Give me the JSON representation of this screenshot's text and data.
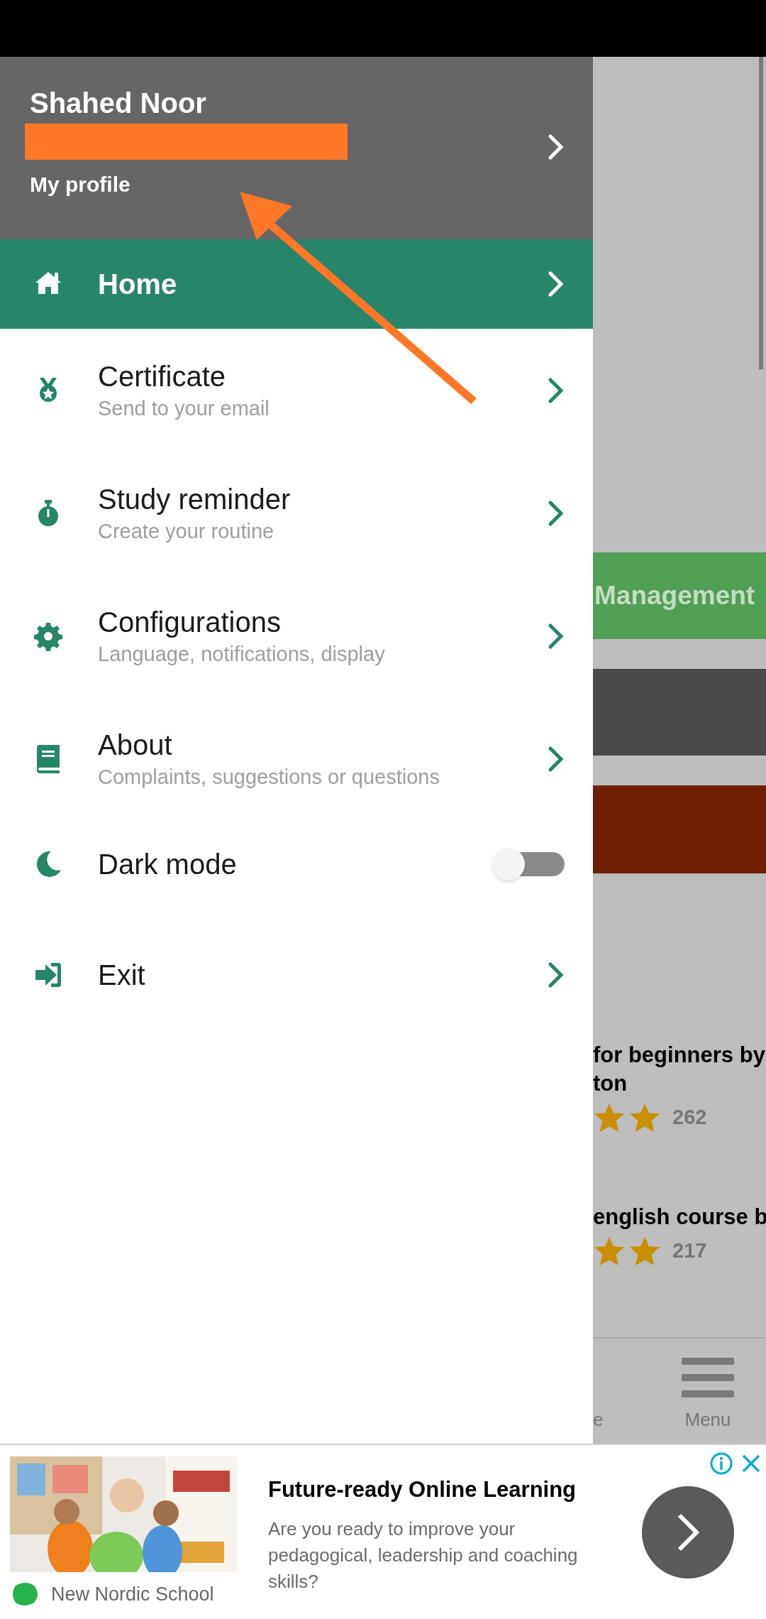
{
  "drawer": {
    "header": {
      "name": "Shahed Noor",
      "link": "My profile"
    },
    "items": [
      {
        "kind": "nav",
        "title": "Home",
        "selected": true
      },
      {
        "kind": "nav",
        "title": "Certificate",
        "subtitle": "Send to your email",
        "selected": false
      },
      {
        "kind": "nav",
        "title": "Study reminder",
        "subtitle": "Create your routine",
        "selected": false
      },
      {
        "kind": "nav",
        "title": "Configurations",
        "subtitle": "Language, notifications, display",
        "selected": false
      },
      {
        "kind": "nav",
        "title": "About",
        "subtitle": "Complaints, suggestions or questions",
        "selected": false
      },
      {
        "kind": "toggle",
        "title": "Dark mode",
        "on": false
      },
      {
        "kind": "nav",
        "title": "Exit",
        "selected": false
      }
    ]
  },
  "background": {
    "banner": "Management",
    "courses": [
      {
        "title_lines": [
          "for beginners by",
          "ton"
        ],
        "rating_count": "262"
      },
      {
        "title_lines": [
          "english course b"
        ],
        "rating_count": "217"
      }
    ],
    "bottom_nav": [
      {
        "label": "e"
      },
      {
        "label": "Menu"
      }
    ]
  },
  "ad": {
    "advertiser": "New Nordic School",
    "headline": "Future-ready Online Learning",
    "body": "Are you ready to improve your pedagogical, leadership and coaching skills?"
  }
}
